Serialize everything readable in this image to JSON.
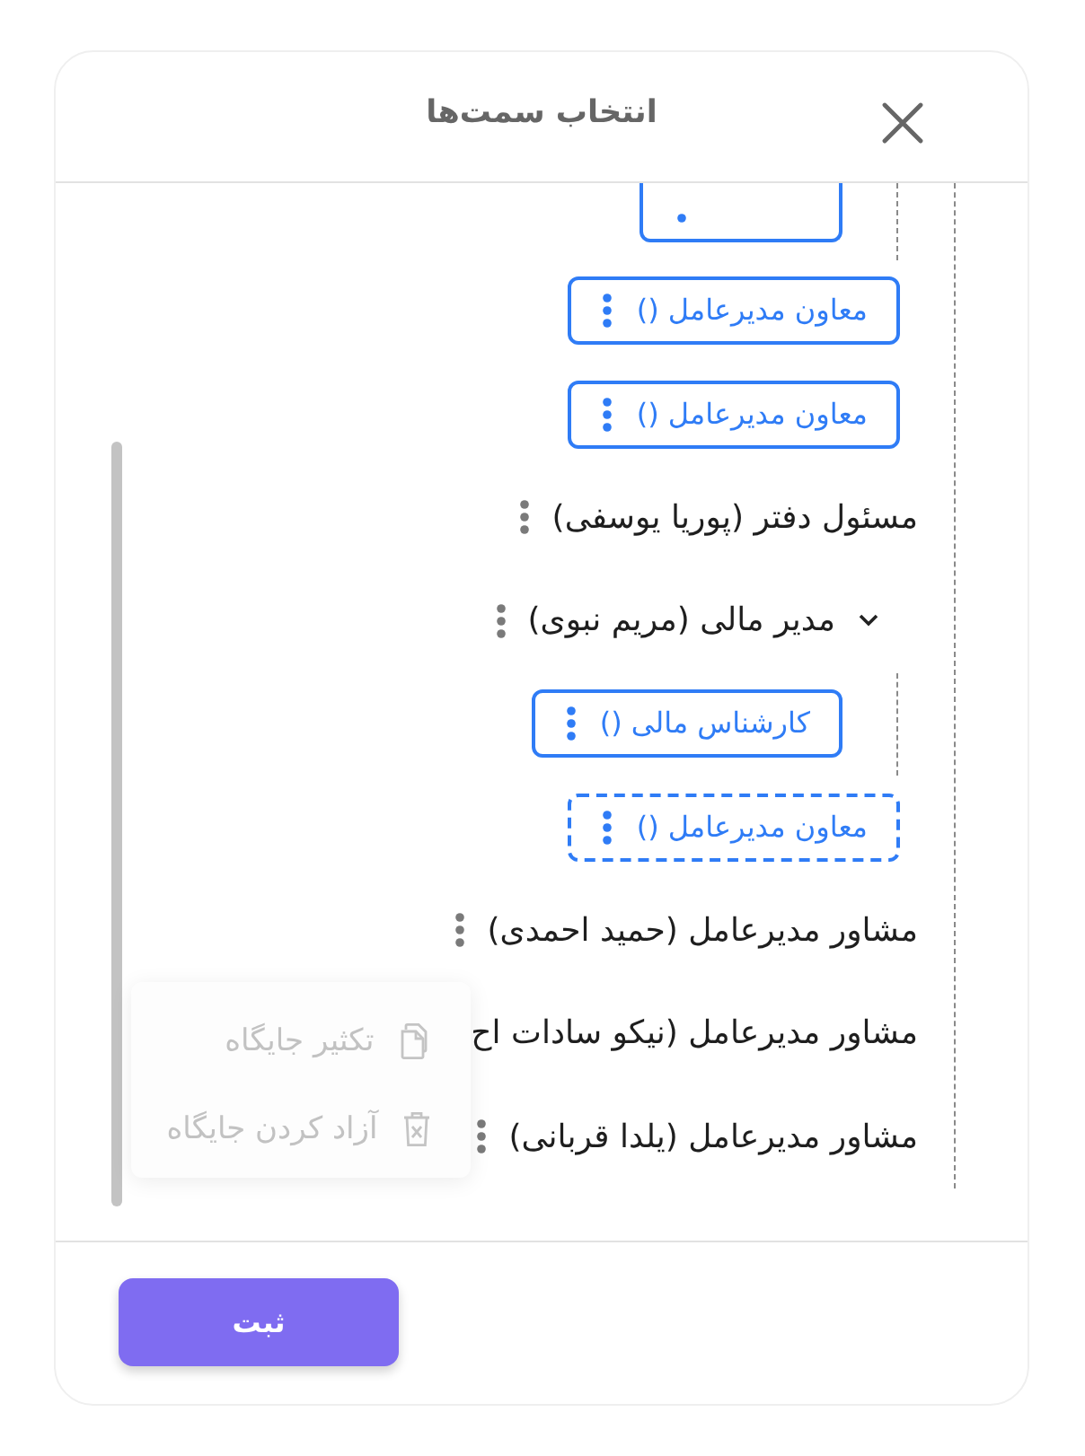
{
  "dialog": {
    "title": "انتخاب سمت‌ها"
  },
  "tree": [
    {
      "kind": "offscreen",
      "children": [
        {
          "kind": "vacant_cut"
        }
      ]
    },
    {
      "kind": "vacant",
      "label": "معاون مدیرعامل ()"
    },
    {
      "kind": "vacant",
      "label": "معاون مدیرعامل ()"
    },
    {
      "kind": "assigned",
      "label": "مسئول دفتر (پوریا یوسفی)",
      "menu_icon": true
    },
    {
      "kind": "assigned",
      "label": "مدیر مالی (مریم نبوی)",
      "menu_icon": true,
      "expanded": true,
      "children": [
        {
          "kind": "vacant",
          "label": "کارشناس مالی ()"
        }
      ]
    },
    {
      "kind": "draft",
      "label": "معاون مدیرعامل ()"
    },
    {
      "kind": "assigned",
      "label": "مشاور مدیرعامل (حمید احمدی)",
      "menu_icon": true,
      "menu": {
        "items": [
          {
            "kind": "duplicate",
            "label": "تکثیر جایگاه",
            "disabled": true
          },
          {
            "kind": "release",
            "label": "آزاد کردن جایگاه",
            "disabled": true
          }
        ]
      }
    },
    {
      "kind": "assigned",
      "label": "مشاور مدیرعامل (نیکو سادات اح",
      "menu_icon": false
    },
    {
      "kind": "assigned",
      "label": "مشاور مدیرعامل (یلدا قربانی)",
      "menu_icon": true
    }
  ],
  "footer": {
    "submit_button": {
      "label": "ثبت"
    }
  }
}
